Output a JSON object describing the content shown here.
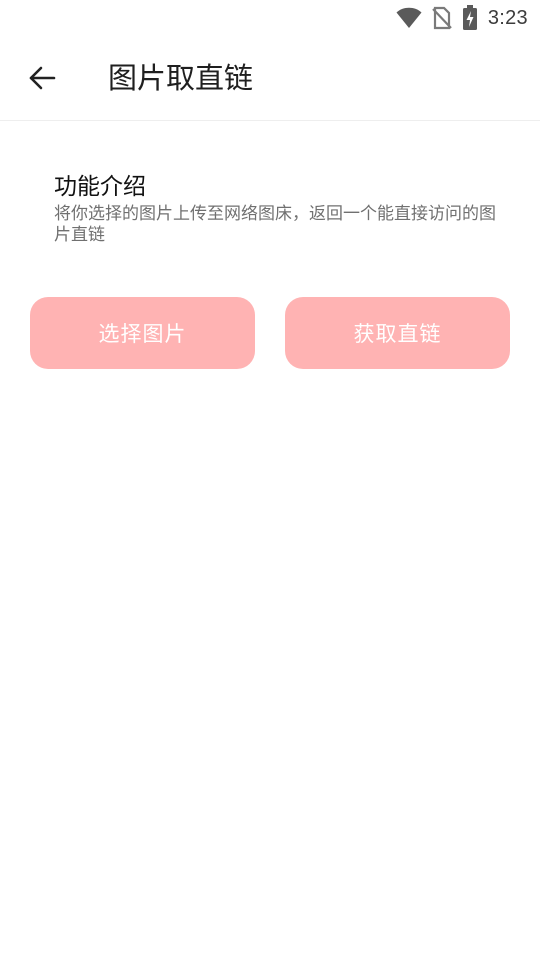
{
  "status_bar": {
    "time": "3:23",
    "icons": [
      "wifi-icon",
      "no-sim-icon",
      "battery-charging-icon"
    ]
  },
  "toolbar": {
    "title": "图片取直链",
    "back_icon": "arrow-left-icon"
  },
  "intro": {
    "title": "功能介绍",
    "description": "将你选择的图片上传至网络图床，返回一个能直接访问的图片直链"
  },
  "actions": {
    "select_image_label": "选择图片",
    "get_link_label": "获取直链"
  },
  "colors": {
    "button_bg": "#ffb3b3",
    "button_text": "#ffffff"
  }
}
